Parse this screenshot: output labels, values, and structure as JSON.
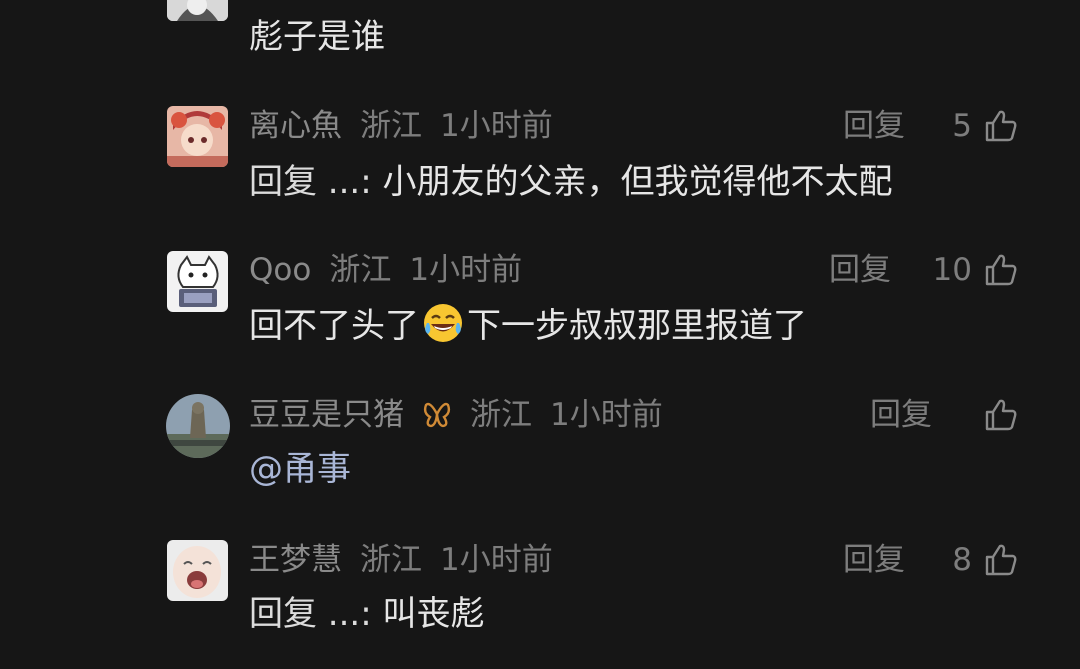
{
  "top_comment": {
    "text": "彪子是谁"
  },
  "comments": [
    {
      "name": "离心魚",
      "location": "浙江",
      "time": "1小时前",
      "reply_label": "回复",
      "likes": "5",
      "prefix": "回复 ...:",
      "text": "小朋友的父亲，但我觉得他不太配"
    },
    {
      "name": "Qoo",
      "location": "浙江",
      "time": "1小时前",
      "reply_label": "回复",
      "likes": "10",
      "text_before": "回不了头了",
      "emoji": "laughing-tears-emoji",
      "text_after": "下一步叔叔那里报道了"
    },
    {
      "name": "豆豆是只猪",
      "location": "浙江",
      "time": "1小时前",
      "reply_label": "回复",
      "likes": "",
      "badge": "butterfly-icon",
      "text": "@甬事"
    },
    {
      "name": "王梦慧",
      "location": "浙江",
      "time": "1小时前",
      "reply_label": "回复",
      "likes": "8",
      "prefix": "回复 ...:",
      "text": "叫丧彪"
    }
  ]
}
